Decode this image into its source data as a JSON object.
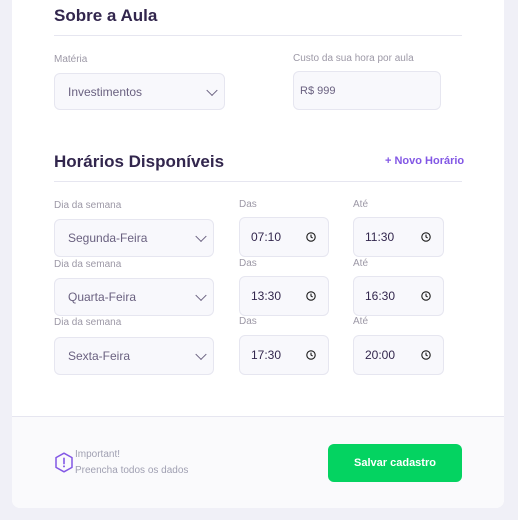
{
  "sobre": {
    "title": "Sobre a Aula",
    "materia_label": "Matéria",
    "materia_value": "Investimentos",
    "custo_label": "Custo da sua hora por aula",
    "custo_value": "R$ 999"
  },
  "horarios": {
    "title": "Horários Disponíveis",
    "add_label": "+ Novo Horário",
    "rows": [
      {
        "dia_label": "Dia da semana",
        "dia_value": "Segunda-Feira",
        "das_label": "Das",
        "das_value": "07:10",
        "ate_label": "Até",
        "ate_value": "11:30"
      },
      {
        "dia_label": "Dia da semana",
        "dia_value": "Quarta-Feira",
        "das_label": "Das",
        "das_value": "13:30",
        "ate_label": "Até",
        "ate_value": "16:30"
      },
      {
        "dia_label": "Dia da semana",
        "dia_value": "Sexta-Feira",
        "das_label": "Das",
        "das_value": "17:30",
        "ate_label": "Até",
        "ate_value": "20:00"
      }
    ]
  },
  "footer": {
    "warning_title": "Important!",
    "warning_text": "Preencha todos os dados",
    "save_label": "Salvar cadastro"
  },
  "colors": {
    "accent": "#8257e5",
    "save": "#04d361",
    "title": "#32264d"
  }
}
